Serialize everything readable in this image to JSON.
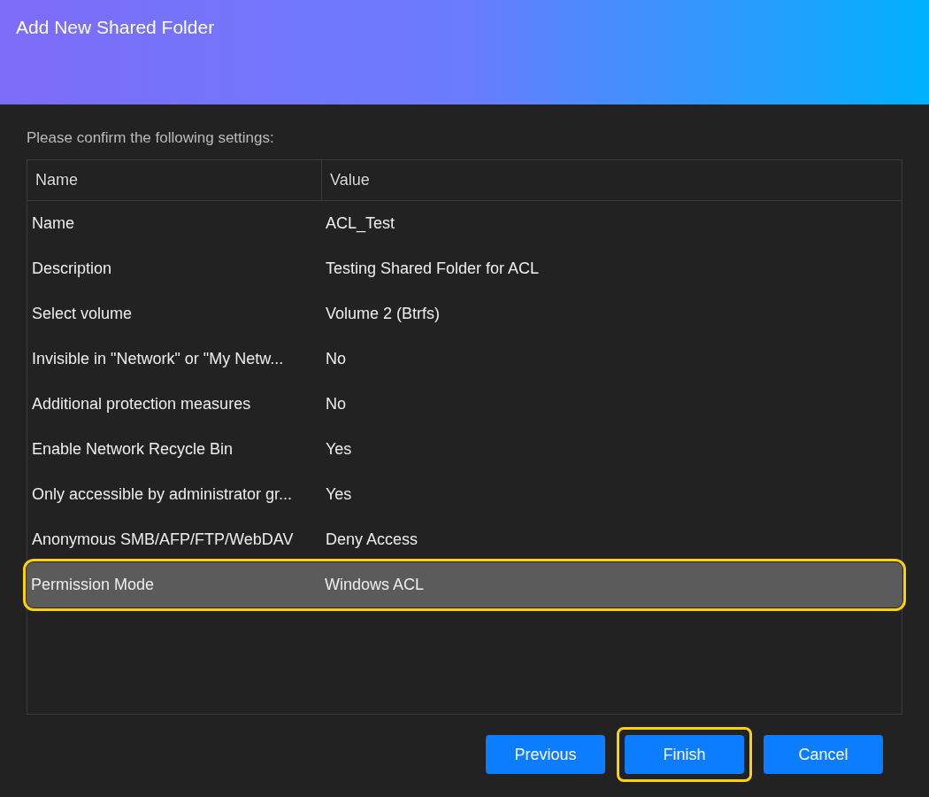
{
  "window": {
    "title": "Add New Shared Folder"
  },
  "intro": "Please confirm the following settings:",
  "table": {
    "columns": [
      "Name",
      "Value"
    ],
    "rows": [
      {
        "name": "Name",
        "value": "ACL_Test",
        "selected": false,
        "highlighted": false
      },
      {
        "name": "Description",
        "value": "Testing Shared Folder for ACL",
        "selected": false,
        "highlighted": false
      },
      {
        "name": "Select volume",
        "value": "Volume 2 (Btrfs)",
        "selected": false,
        "highlighted": false
      },
      {
        "name": "Invisible in \"Network\" or \"My Netw...",
        "value": "No",
        "selected": false,
        "highlighted": false
      },
      {
        "name": "Additional protection measures",
        "value": "No",
        "selected": false,
        "highlighted": false
      },
      {
        "name": "Enable Network Recycle Bin",
        "value": "Yes",
        "selected": false,
        "highlighted": false
      },
      {
        "name": "Only accessible by administrator gr...",
        "value": "Yes",
        "selected": false,
        "highlighted": false
      },
      {
        "name": "Anonymous SMB/AFP/FTP/WebDAV",
        "value": "Deny Access",
        "selected": false,
        "highlighted": false
      },
      {
        "name": "Permission Mode",
        "value": "Windows ACL",
        "selected": true,
        "highlighted": true
      }
    ]
  },
  "buttons": [
    {
      "label": "Previous",
      "highlighted": false
    },
    {
      "label": "Finish",
      "highlighted": true
    },
    {
      "label": "Cancel",
      "highlighted": false
    }
  ]
}
